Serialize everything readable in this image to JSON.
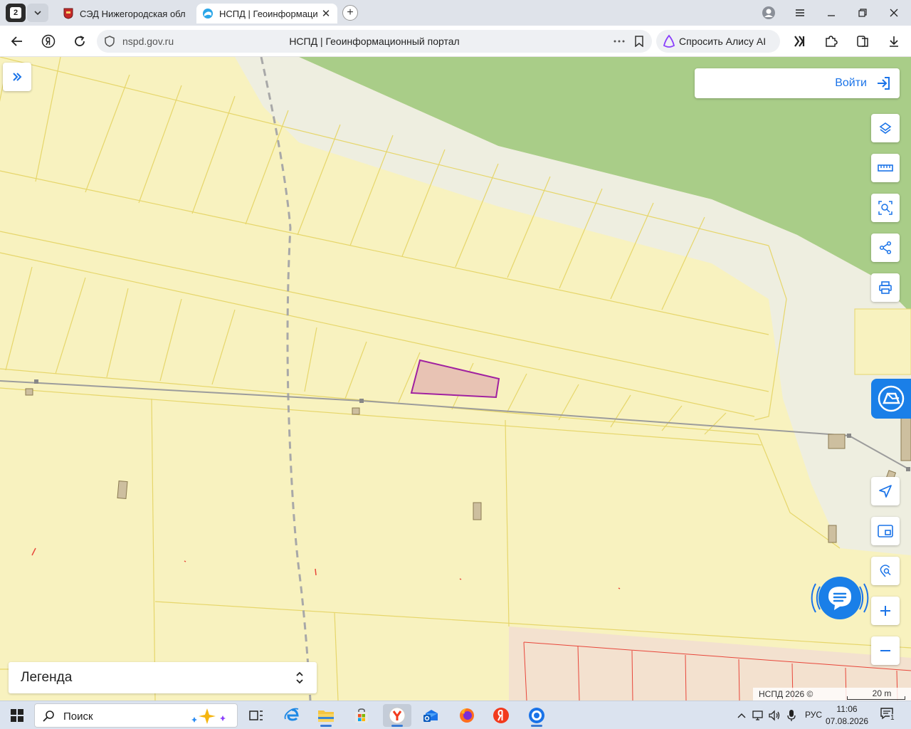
{
  "browser": {
    "tab_count": "2",
    "tabs": [
      {
        "label": "СЭД Нижегородская обл",
        "active": false
      },
      {
        "label": "НСПД | Геоинформаци",
        "active": true
      }
    ],
    "url": "nspd.gov.ru",
    "page_title": "НСПД | Геоинформационный портал",
    "alice_label": "Спросить Алису AI"
  },
  "map": {
    "login_label": "Войти",
    "legend_label": "Легенда",
    "copyright": "НСПД 2026 ©",
    "scale": "20 m",
    "colors": {
      "land": "#f8f2bf",
      "parcel_border": "#e6d66b",
      "forest": "#a9cd88",
      "road": "#eeeee0",
      "selected_fill": "#e8c3b4",
      "selected_border": "#a020a0",
      "accent": "#1a73e8",
      "zone_border": "#e8463a",
      "building": "#cdbf9f"
    }
  },
  "taskbar": {
    "search_label": "Поиск",
    "language": "РУС",
    "time": "11:06",
    "date": "07.08.2026",
    "notification_count": "1"
  }
}
